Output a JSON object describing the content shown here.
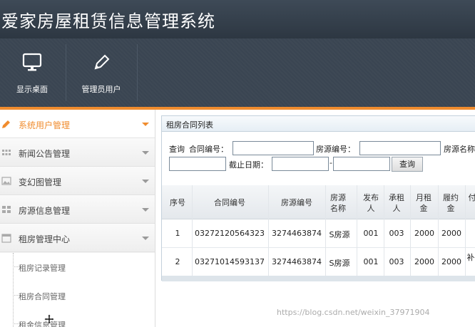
{
  "app": {
    "title": "爱家房屋租赁信息管理系统"
  },
  "toolbar": {
    "items": [
      {
        "label": "显示桌面",
        "icon": "monitor-icon"
      },
      {
        "label": "管理员用户",
        "icon": "pencil-icon"
      }
    ]
  },
  "sidebar": {
    "items": [
      {
        "label": "系统用户管理",
        "icon": "pencil-icon",
        "active": true
      },
      {
        "label": "新闻公告管理",
        "icon": "grid-icon"
      },
      {
        "label": "变幻图管理",
        "icon": "image-icon"
      },
      {
        "label": "房源信息管理",
        "icon": "tiles-icon"
      },
      {
        "label": "租房管理中心",
        "icon": "calendar-icon"
      }
    ],
    "subitems": [
      {
        "label": "租房记录管理"
      },
      {
        "label": "租房合同管理"
      },
      {
        "label": "租金信息管理"
      }
    ]
  },
  "panel": {
    "title": "租房合同列表",
    "query": {
      "prefix": "查询",
      "contract_no_label": "合同编号：",
      "house_no_label": "房源编号：",
      "house_name_label": "房源名称",
      "end_date_label": "截止日期：",
      "date_separator": "-",
      "search_button": "查询"
    }
  },
  "table": {
    "columns": [
      "序号",
      "合同编号",
      "房源编号",
      "房源名称",
      "发布人",
      "承租人",
      "月租金",
      "履约金",
      "付"
    ],
    "rows": [
      [
        "1",
        "03272120564323",
        "3274463874",
        "S房源",
        "001",
        "003",
        "2000",
        "2000",
        ""
      ],
      [
        "2",
        "03271014593137",
        "3274463874",
        "S房源",
        "001",
        "003",
        "2000",
        "2000",
        "补"
      ]
    ]
  },
  "watermark": "https://blog.csdn.net/weixin_37971904",
  "colors": {
    "accent": "#f08c2e",
    "header": "#2d3742",
    "toolbar": "#3a4552"
  }
}
